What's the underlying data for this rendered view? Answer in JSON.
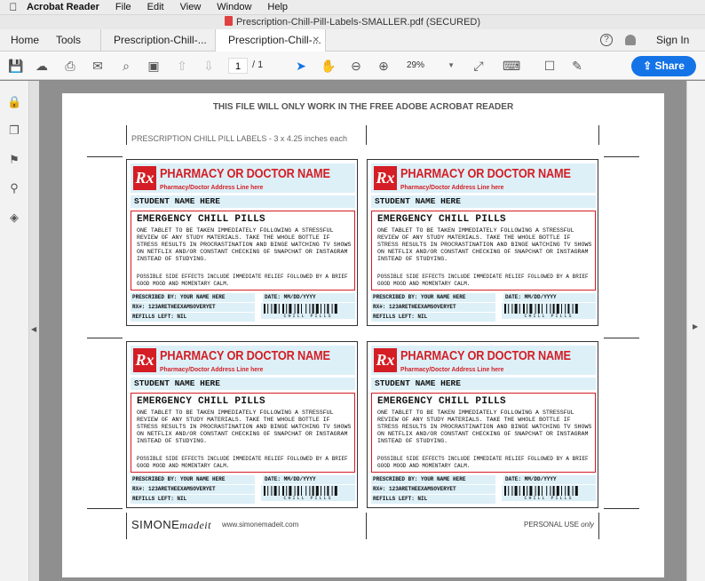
{
  "menubar": {
    "app": "Acrobat Reader",
    "items": [
      "File",
      "Edit",
      "View",
      "Window",
      "Help"
    ]
  },
  "window": {
    "title": "Prescription-Chill-Pill-Labels-SMALLER.pdf (SECURED)"
  },
  "tabs": {
    "home": "Home",
    "tools": "Tools",
    "tab1": "Prescription-Chill-...",
    "tab2": "Prescription-Chill-...",
    "signin": "Sign In"
  },
  "toolbar": {
    "page_current": "1",
    "page_total": "/ 1",
    "zoom": "29%",
    "share": "Share"
  },
  "page": {
    "notice": "THIS FILE WILL ONLY WORK IN THE FREE ADOBE ACROBAT READER",
    "subtitle": "PRESCRIPTION CHILL PILL LABELS - 3 x 4.25 inches each",
    "logo_main": "SIMONE",
    "logo_script": "madeit",
    "website": "www.simonemadeit.com",
    "personal": "PERSONAL USE",
    "personal_script": "only"
  },
  "label": {
    "rx": "Rx",
    "pharmacy": "PHARMACY OR DOCTOR NAME",
    "address": "Pharmacy/Doctor Address Line here",
    "student": "STUDENT NAME HERE",
    "title": "EMERGENCY CHILL PILLS",
    "instructions": "ONE TABLET TO BE TAKEN IMMEDIATELY FOLLOWING A STRESSFUL REVIEW OF ANY STUDY MATERIALS. TAKE THE WHOLE BOTTLE IF STRESS RESULTS IN PROCRASTINATION AND BINGE WATCHING TV SHOWS ON NETFLIX AND/OR CONSTANT CHECKING OF SNAPCHAT OR INSTAGRAM INSTEAD OF STUDYING.",
    "side_effects": "POSSIBLE SIDE EFFECTS INCLUDE IMMEDIATE RELIEF FOLLOWED BY A BRIEF GOOD MOOD AND MOMENTARY CALM.",
    "prescribed_by": "PRESCRIBED BY: YOUR NAME HERE",
    "rx_number": "RX#: 123ARETHEEXAMSOVERYET",
    "refills": "REFILLS LEFT: NIL",
    "date": "DATE: MM/DD/YYYY",
    "barcode_text": "CHILL PILLS"
  },
  "icons": {
    "apple": "apple-logo-icon",
    "save": "save-icon",
    "upload": "upload-icon",
    "print": "print-icon",
    "email": "email-icon",
    "search": "search-zoom-icon",
    "screenshot": "screenshot-icon",
    "prev": "prev-page-icon",
    "next": "next-page-icon",
    "select": "select-arrow-icon",
    "hand": "hand-icon",
    "zoomout": "zoom-out-icon",
    "zoomin": "zoom-in-icon"
  },
  "colors": {
    "accent": "#1473e6",
    "rx_red": "#d41d24",
    "label_blue": "#ddf0f8"
  }
}
